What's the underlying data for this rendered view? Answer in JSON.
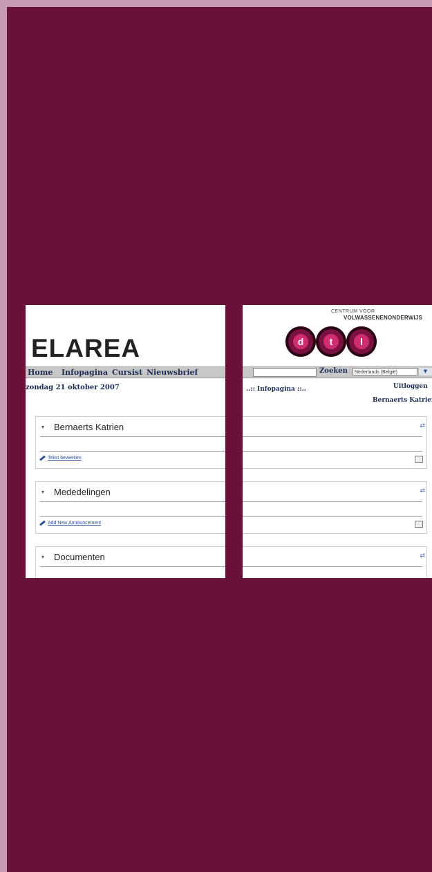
{
  "left": {
    "logo": "ELAREA",
    "nav": [
      "Home",
      "Infopagina",
      "Cursist",
      "Nieuwsbrief"
    ],
    "date": "zondag 21 oktober 2007",
    "boxes": [
      {
        "title": "Bernaerts Katrien",
        "link": "Tekst bewerken"
      },
      {
        "title": "Mededelingen",
        "link": "Add New Announcement"
      },
      {
        "title": "Documenten"
      }
    ]
  },
  "right": {
    "org_line1": "CENTRUM VOOR",
    "org_line2": "VOLWASSENENONDERWIJS",
    "logo_letters": [
      "d",
      "t",
      "l"
    ],
    "search_button": "Zoeken",
    "language_selected": "Nederlands (België)",
    "page_heading": "..:: Infopagina ::..",
    "logout": "Uitloggen",
    "user": "Bernaerts Katrien",
    "icons": {
      "edit": "edit-icon",
      "print": "print-icon"
    }
  },
  "colors": {
    "background": "#6a1139",
    "outer_border": "#c79bb2",
    "nav_text": "#1e2d55",
    "logo_circle": "#7a1140"
  }
}
